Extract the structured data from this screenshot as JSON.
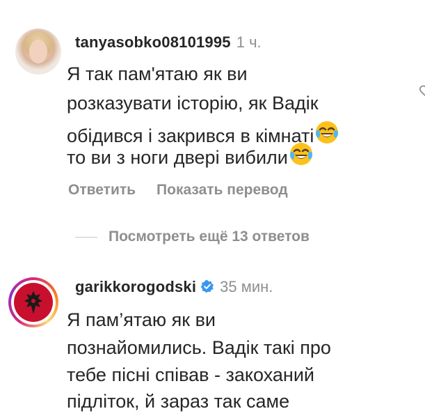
{
  "comments": [
    {
      "username": "tanyasobko08101995",
      "time": "1 ч.",
      "text_lines": [
        "Я так пам'ятаю як ви",
        "розказувати історію, як Вадік",
        "обідився і закрився в кімнаті",
        "то ви з ноги двері вибили"
      ],
      "emoji": "face-with-tears-of-joy",
      "actions": {
        "reply": "Ответить",
        "translate": "Показать перевод"
      },
      "more_replies": "Посмотреть ещё 13 ответов"
    },
    {
      "username": "garikkorogodski",
      "verified": true,
      "time": "35 мин.",
      "text_lines": [
        "Я пам’ятаю як ви",
        "познайомились. Вадік такі про",
        "тебе пісні співав - закоханий",
        "підліток, й зараз так саме"
      ]
    }
  ],
  "colors": {
    "text": "#262626",
    "secondary": "#8e8e8e",
    "verified": "#3897f0",
    "logo_red": "#c8102e"
  }
}
